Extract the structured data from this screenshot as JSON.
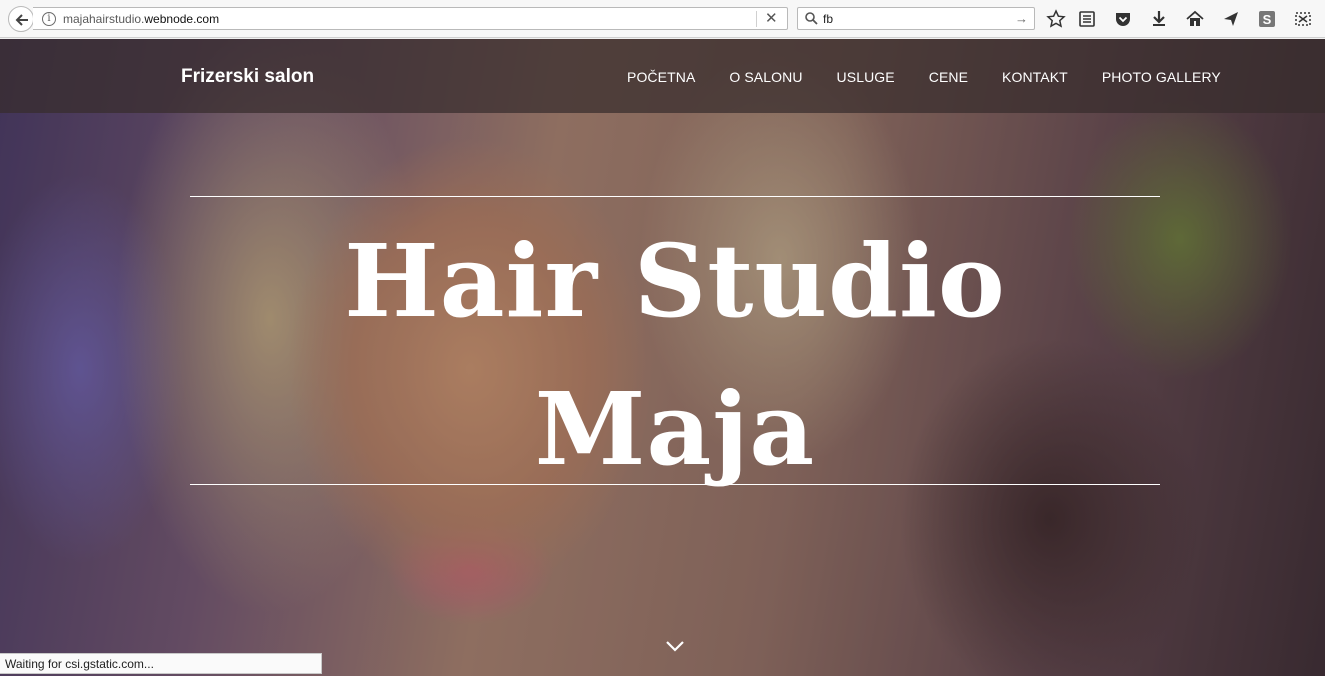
{
  "browser": {
    "url_host_prefix": "majahairstudio.",
    "url_domain": "webnode.com",
    "search_value": "fb",
    "status_text": "Waiting for csi.gstatic.com..."
  },
  "site": {
    "brand": "Frizerski salon",
    "nav": [
      "POČETNA",
      "O SALONU",
      "USLUGE",
      "CENE",
      "KONTAKT",
      "PHOTO GALLERY"
    ],
    "hero_title_line1": "Hair Studio",
    "hero_title_line2": "Maja"
  },
  "icons": [
    "back-arrow-icon",
    "info-icon",
    "close-icon",
    "search-icon",
    "arrow-right-icon",
    "star-icon",
    "reading-list-icon",
    "pocket-icon",
    "download-icon",
    "home-icon",
    "send-icon",
    "s-extension-icon",
    "screenshot-icon",
    "chevron-down-icon"
  ]
}
